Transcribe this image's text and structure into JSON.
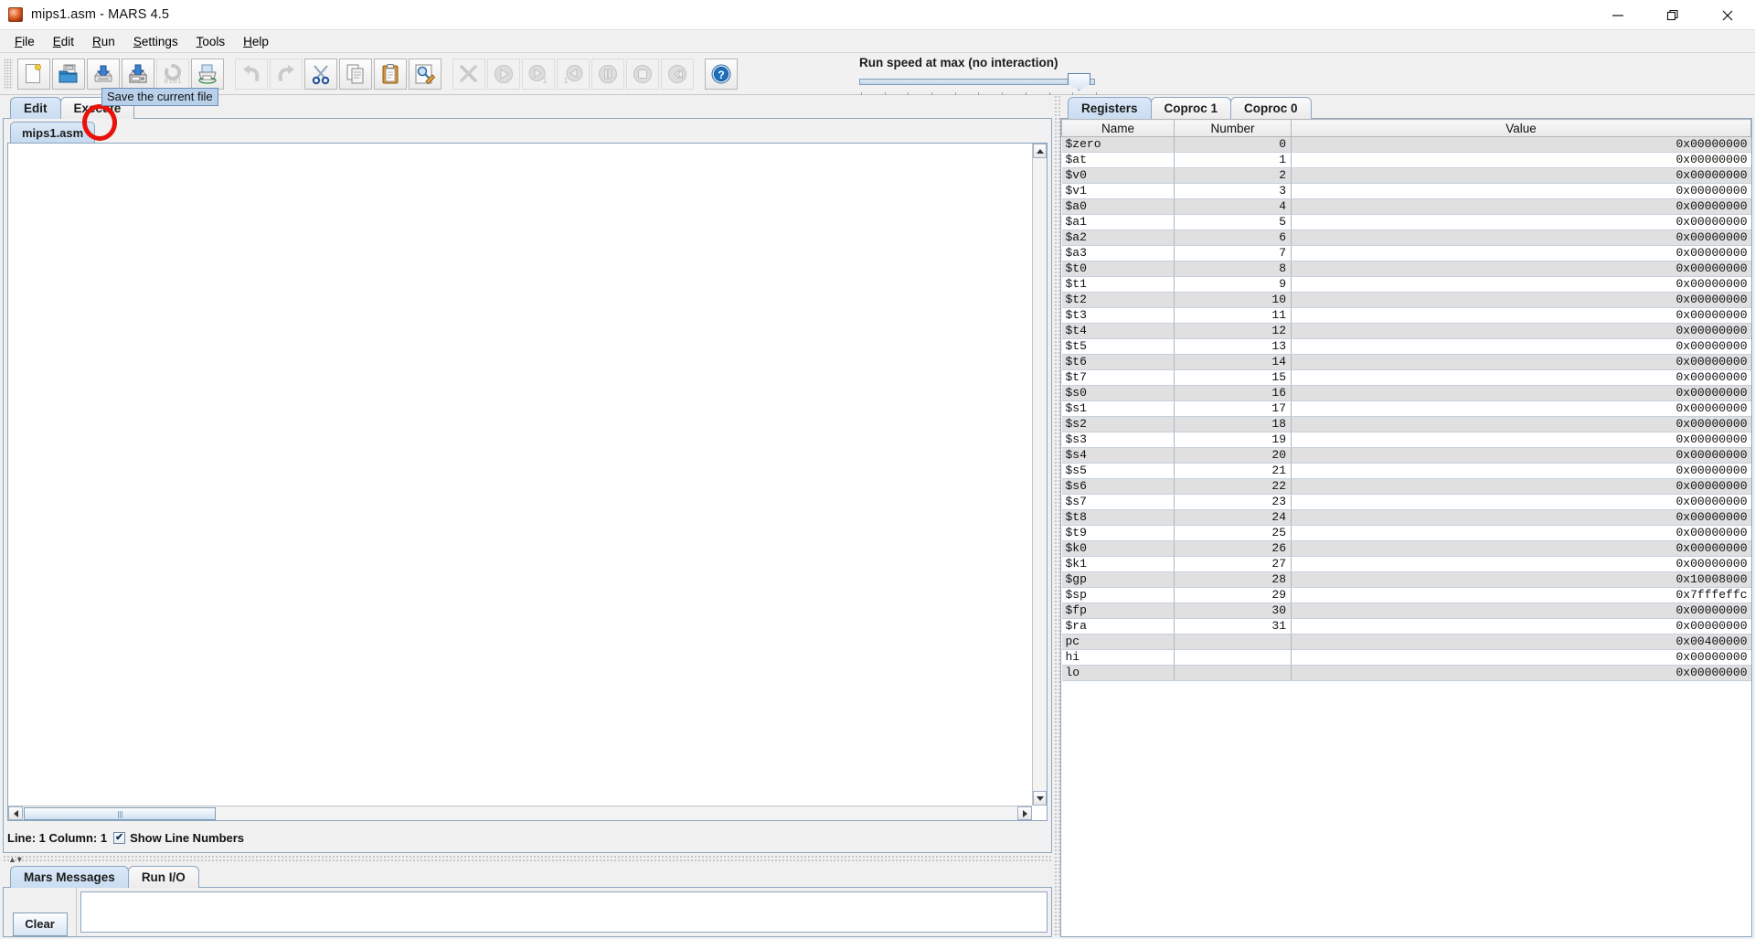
{
  "window": {
    "title": "mips1.asm  - MARS 4.5",
    "app_icon": "mars-planet-icon",
    "minimize_label": "—",
    "maximize_label": "❐",
    "close_label": "✕"
  },
  "menubar": {
    "items": [
      {
        "label": "File",
        "mnemonic": "F"
      },
      {
        "label": "Edit",
        "mnemonic": "E"
      },
      {
        "label": "Run",
        "mnemonic": "R"
      },
      {
        "label": "Settings",
        "mnemonic": "S"
      },
      {
        "label": "Tools",
        "mnemonic": "T"
      },
      {
        "label": "Help",
        "mnemonic": "H"
      }
    ]
  },
  "toolbar": {
    "buttons": [
      {
        "name": "new-file-button",
        "icon": "new-document-icon",
        "enabled": true
      },
      {
        "name": "open-file-button",
        "icon": "open-folder-icon",
        "enabled": true
      },
      {
        "name": "save-file-button",
        "icon": "save-disk-icon",
        "enabled": true,
        "highlighted": true
      },
      {
        "name": "save-as-button",
        "icon": "save-as-disk-icon",
        "enabled": true
      },
      {
        "name": "dump-memory-button",
        "icon": "dump-0101-icon",
        "enabled": false
      },
      {
        "name": "print-button",
        "icon": "printer-icon",
        "enabled": true
      },
      {
        "name": "undo-button",
        "icon": "undo-arrow-icon",
        "enabled": false
      },
      {
        "name": "redo-button",
        "icon": "redo-arrow-icon",
        "enabled": false
      },
      {
        "name": "cut-button",
        "icon": "scissors-icon",
        "enabled": true
      },
      {
        "name": "copy-button",
        "icon": "copy-pages-icon",
        "enabled": true
      },
      {
        "name": "paste-button",
        "icon": "clipboard-icon",
        "enabled": true
      },
      {
        "name": "find-replace-button",
        "icon": "magnifier-pencil-icon",
        "enabled": true
      },
      {
        "name": "assemble-button",
        "icon": "wrench-screwdriver-icon",
        "enabled": false
      },
      {
        "name": "run-button",
        "icon": "play-circle-icon",
        "enabled": false
      },
      {
        "name": "step-forward-button",
        "icon": "play-one-step-icon",
        "enabled": false
      },
      {
        "name": "step-backward-button",
        "icon": "back-one-step-icon",
        "enabled": false
      },
      {
        "name": "pause-button",
        "icon": "pause-circle-icon",
        "enabled": false
      },
      {
        "name": "stop-button",
        "icon": "stop-circle-icon",
        "enabled": false
      },
      {
        "name": "reset-button",
        "icon": "rewind-circle-icon",
        "enabled": false
      },
      {
        "name": "help-button",
        "icon": "question-help-icon",
        "enabled": true
      }
    ],
    "run_speed_label": "Run speed at max (no interaction)",
    "slider_value_percent": 100,
    "tick_count": 10
  },
  "annotation": {
    "type": "red-circle-highlight",
    "color": "#e8120b",
    "target": "save-file-button"
  },
  "tooltip": {
    "text": "Save the current file",
    "background": "#b9d0ea"
  },
  "left_panel": {
    "tabs": [
      {
        "label": "Edit",
        "active": true
      },
      {
        "label": "Execute",
        "active": false
      }
    ],
    "file_tabs": [
      {
        "label": "mips1.asm",
        "active": true
      }
    ],
    "editor_content": "",
    "status": {
      "line_column": "Line: 1 Column: 1",
      "show_line_numbers_label": "Show Line Numbers",
      "show_line_numbers_checked": true,
      "checkmark": "✔"
    }
  },
  "message_panel": {
    "tabs": [
      {
        "label": "Mars Messages",
        "active": true
      },
      {
        "label": "Run I/O",
        "active": false
      }
    ],
    "clear_label": "Clear",
    "content": ""
  },
  "registers_panel": {
    "tabs": [
      {
        "label": "Registers",
        "active": true
      },
      {
        "label": "Coproc 1",
        "active": false
      },
      {
        "label": "Coproc 0",
        "active": false
      }
    ],
    "columns": [
      "Name",
      "Number",
      "Value"
    ],
    "rows": [
      {
        "name": "$zero",
        "number": "0",
        "value": "0x00000000"
      },
      {
        "name": "$at",
        "number": "1",
        "value": "0x00000000"
      },
      {
        "name": "$v0",
        "number": "2",
        "value": "0x00000000"
      },
      {
        "name": "$v1",
        "number": "3",
        "value": "0x00000000"
      },
      {
        "name": "$a0",
        "number": "4",
        "value": "0x00000000"
      },
      {
        "name": "$a1",
        "number": "5",
        "value": "0x00000000"
      },
      {
        "name": "$a2",
        "number": "6",
        "value": "0x00000000"
      },
      {
        "name": "$a3",
        "number": "7",
        "value": "0x00000000"
      },
      {
        "name": "$t0",
        "number": "8",
        "value": "0x00000000"
      },
      {
        "name": "$t1",
        "number": "9",
        "value": "0x00000000"
      },
      {
        "name": "$t2",
        "number": "10",
        "value": "0x00000000"
      },
      {
        "name": "$t3",
        "number": "11",
        "value": "0x00000000"
      },
      {
        "name": "$t4",
        "number": "12",
        "value": "0x00000000"
      },
      {
        "name": "$t5",
        "number": "13",
        "value": "0x00000000"
      },
      {
        "name": "$t6",
        "number": "14",
        "value": "0x00000000"
      },
      {
        "name": "$t7",
        "number": "15",
        "value": "0x00000000"
      },
      {
        "name": "$s0",
        "number": "16",
        "value": "0x00000000"
      },
      {
        "name": "$s1",
        "number": "17",
        "value": "0x00000000"
      },
      {
        "name": "$s2",
        "number": "18",
        "value": "0x00000000"
      },
      {
        "name": "$s3",
        "number": "19",
        "value": "0x00000000"
      },
      {
        "name": "$s4",
        "number": "20",
        "value": "0x00000000"
      },
      {
        "name": "$s5",
        "number": "21",
        "value": "0x00000000"
      },
      {
        "name": "$s6",
        "number": "22",
        "value": "0x00000000"
      },
      {
        "name": "$s7",
        "number": "23",
        "value": "0x00000000"
      },
      {
        "name": "$t8",
        "number": "24",
        "value": "0x00000000"
      },
      {
        "name": "$t9",
        "number": "25",
        "value": "0x00000000"
      },
      {
        "name": "$k0",
        "number": "26",
        "value": "0x00000000"
      },
      {
        "name": "$k1",
        "number": "27",
        "value": "0x00000000"
      },
      {
        "name": "$gp",
        "number": "28",
        "value": "0x10008000"
      },
      {
        "name": "$sp",
        "number": "29",
        "value": "0x7fffeffc"
      },
      {
        "name": "$fp",
        "number": "30",
        "value": "0x00000000"
      },
      {
        "name": "$ra",
        "number": "31",
        "value": "0x00000000"
      },
      {
        "name": "pc",
        "number": "",
        "value": "0x00400000"
      },
      {
        "name": "hi",
        "number": "",
        "value": "0x00000000"
      },
      {
        "name": "lo",
        "number": "",
        "value": "0x00000000"
      }
    ]
  }
}
